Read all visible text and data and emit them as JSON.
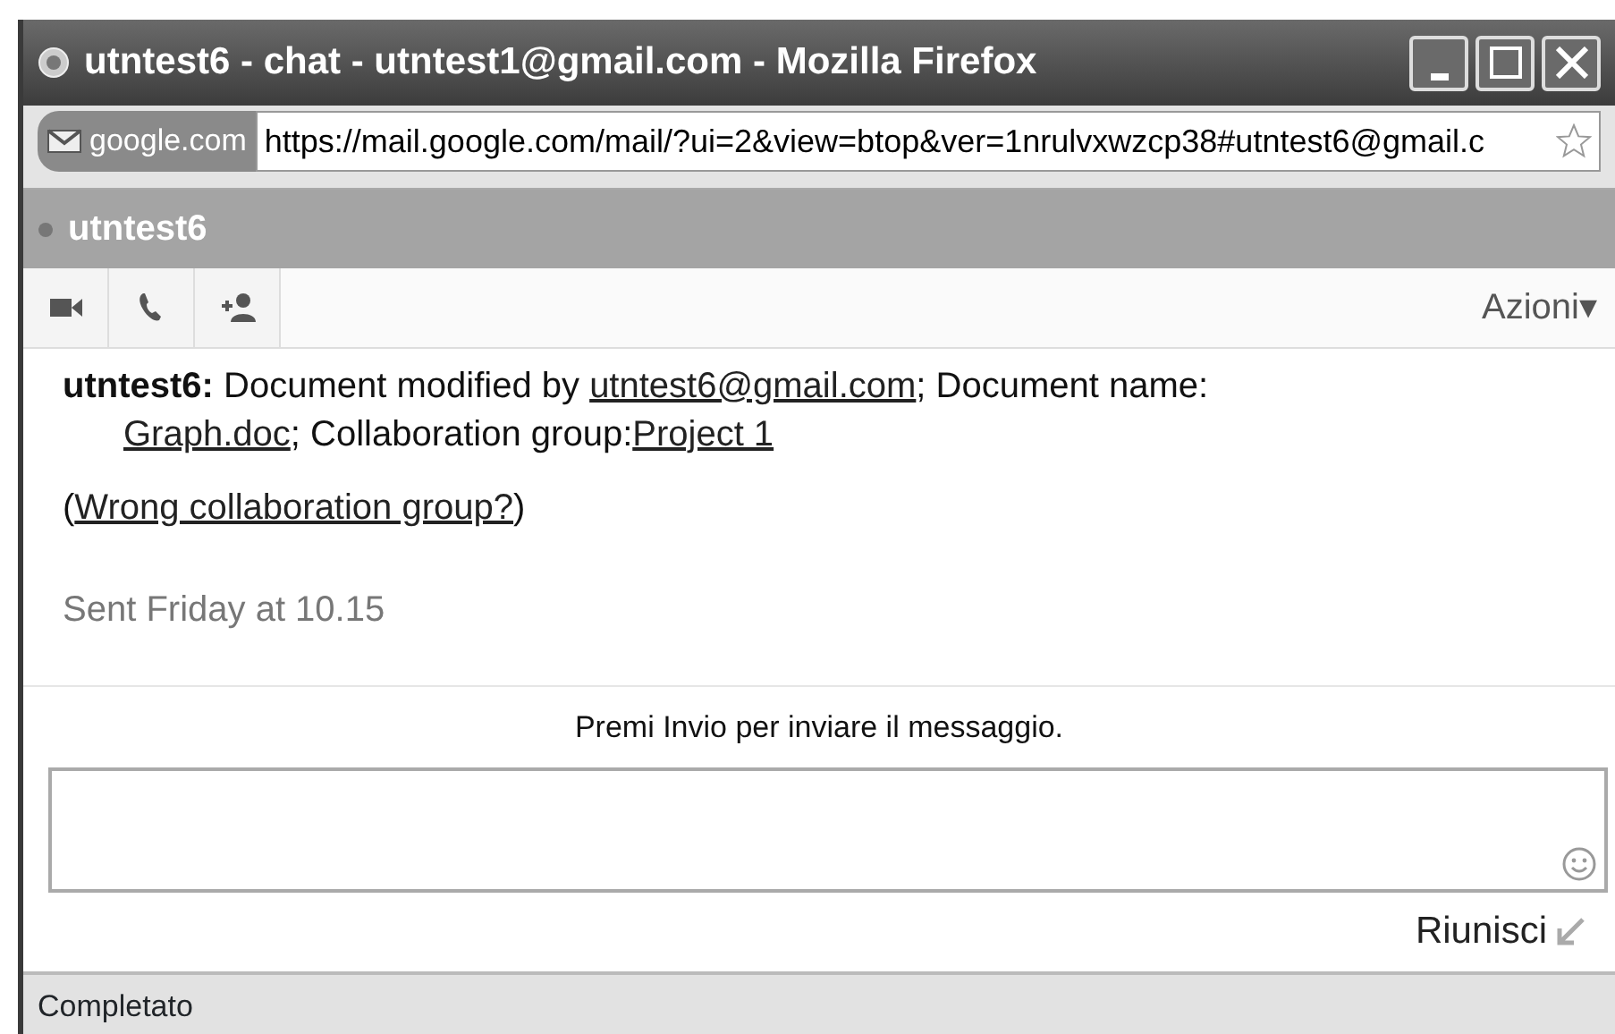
{
  "window": {
    "title": "utntest6 - chat - utntest1@gmail.com - Mozilla Firefox"
  },
  "address_bar": {
    "site": "google.com",
    "url": "https://mail.google.com/mail/?ui=2&view=btop&ver=1nrulvxwzcp38#utntest6@gmail.c"
  },
  "chat": {
    "contact": "utntest6",
    "actions_menu": "Azioni▾",
    "message": {
      "lines": [
        [
          {
            "kind": "text",
            "text": "**utntest6:** Document modified by "
          },
          {
            "kind": "link",
            "text": "utntest6@gmail.com"
          },
          {
            "kind": "text",
            "text": "; Document name:"
          }
        ],
        [
          {
            "kind": "link",
            "text": "Graph.doc"
          },
          {
            "kind": "text",
            "text": "; Collaboration group:"
          },
          {
            "kind": "link",
            "text": "Project 1"
          }
        ]
      ],
      "note": [
        {
          "kind": "text",
          "text": "("
        },
        {
          "kind": "link",
          "text": "Wrong collaboration group?"
        },
        {
          "kind": "text",
          "text": ")"
        }
      ],
      "sent": "Sent Friday at 10.15"
    },
    "hint": "Premi Invio per inviare il messaggio.",
    "popin": "Riunisci"
  },
  "status_bar": "Completato"
}
